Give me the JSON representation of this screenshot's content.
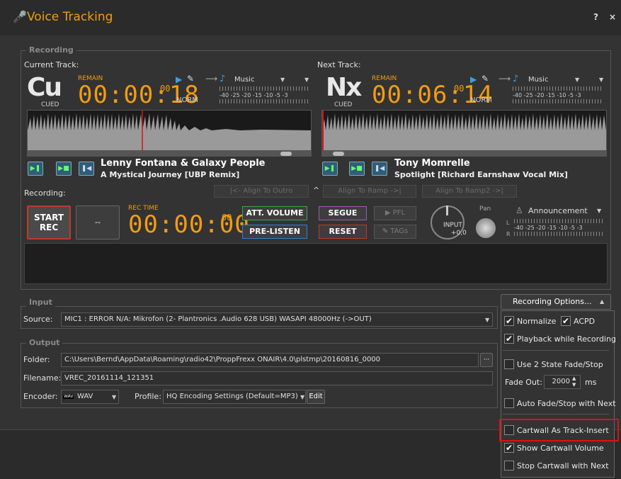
{
  "window": {
    "title": "Voice Tracking",
    "help": "?",
    "close": "×"
  },
  "recording_group": {
    "title": "Recording"
  },
  "current": {
    "label": "Current Track:",
    "big": "Cu",
    "cued": "CUED",
    "remain_label": "REMAIN",
    "remain": "00:00:18",
    "remain_frac": "00",
    "norm": "NORM",
    "source": "Music",
    "artist": "Lenny Fontana & Galaxy People",
    "song": "A Mystical Journey [UBP Remix]"
  },
  "next": {
    "label": "Next Track:",
    "big": "Nx",
    "cued": "CUED",
    "remain_label": "REMAIN",
    "remain": "00:06:14",
    "remain_frac": "00",
    "norm": "NORM",
    "source": "Music",
    "artist": "Tony Momrelle",
    "song": "Spotlight [Richard Earnshaw Vocal Mix]"
  },
  "meter_scale": "-40 -25 -20 -15 -10 -5 -3",
  "align": {
    "outro": "|<- Align To Outro",
    "ramp": "Align To Ramp ->|",
    "ramp2": "Align To Ramp2 ->|",
    "caret": "^"
  },
  "rec": {
    "label": "Recording:",
    "start_line1": "START",
    "start_line2": "REC",
    "dash": "--",
    "rec_time_label": "REC TIME",
    "rec_time": "00:00:00",
    "rec_frac": "00",
    "att_volume": "ATT. VOLUME",
    "pre_listen": "PRE-LISTEN",
    "segue": "SEGUE",
    "reset": "RESET",
    "pfl": "PFL",
    "tags": "TAGs",
    "input_label": "INPUT",
    "input_value": "+0,0",
    "pan_label": "Pan",
    "announcement": "Announcement",
    "l": "L",
    "r": "R"
  },
  "input_group": {
    "title": "Input",
    "source_label": "Source:",
    "source_value": "MIC1 : ERROR N/A: Mikrofon (2- Plantronics .Audio 628 USB) WASAPI 48000Hz (->OUT)"
  },
  "output_group": {
    "title": "Output",
    "folder_label": "Folder:",
    "folder_value": "C:\\Users\\Bernd\\AppData\\Roaming\\radio42\\ProppFrexx ONAIR\\4.0\\plstmp\\20160816_0000",
    "browse": "···",
    "filename_label": "Filename:",
    "filename_value": "VREC_20161114_121351",
    "encoder_label": "Encoder:",
    "encoder_value": "WAV",
    "encoder_icon": "WAV",
    "profile_label": "Profile:",
    "profile_value": "HQ Encoding Settings (Default=MP3)",
    "edit": "Edit"
  },
  "options": {
    "button": "Recording Options...",
    "normalize": "Normalize",
    "acpd": "ACPD",
    "playback": "Playback while Recording",
    "two_state": "Use 2 State Fade/Stop",
    "fade_out_label": "Fade Out:",
    "fade_out_value": "2000",
    "fade_out_unit": "ms",
    "auto_fade": "Auto Fade/Stop with Next",
    "cartwall_insert": "Cartwall As Track-Insert",
    "show_cartwall": "Show Cartwall Volume",
    "stop_cartwall": "Stop Cartwall with Next",
    "check": "✔"
  },
  "colors": {
    "accent": "#f39c12",
    "highlight": "#e01010"
  }
}
